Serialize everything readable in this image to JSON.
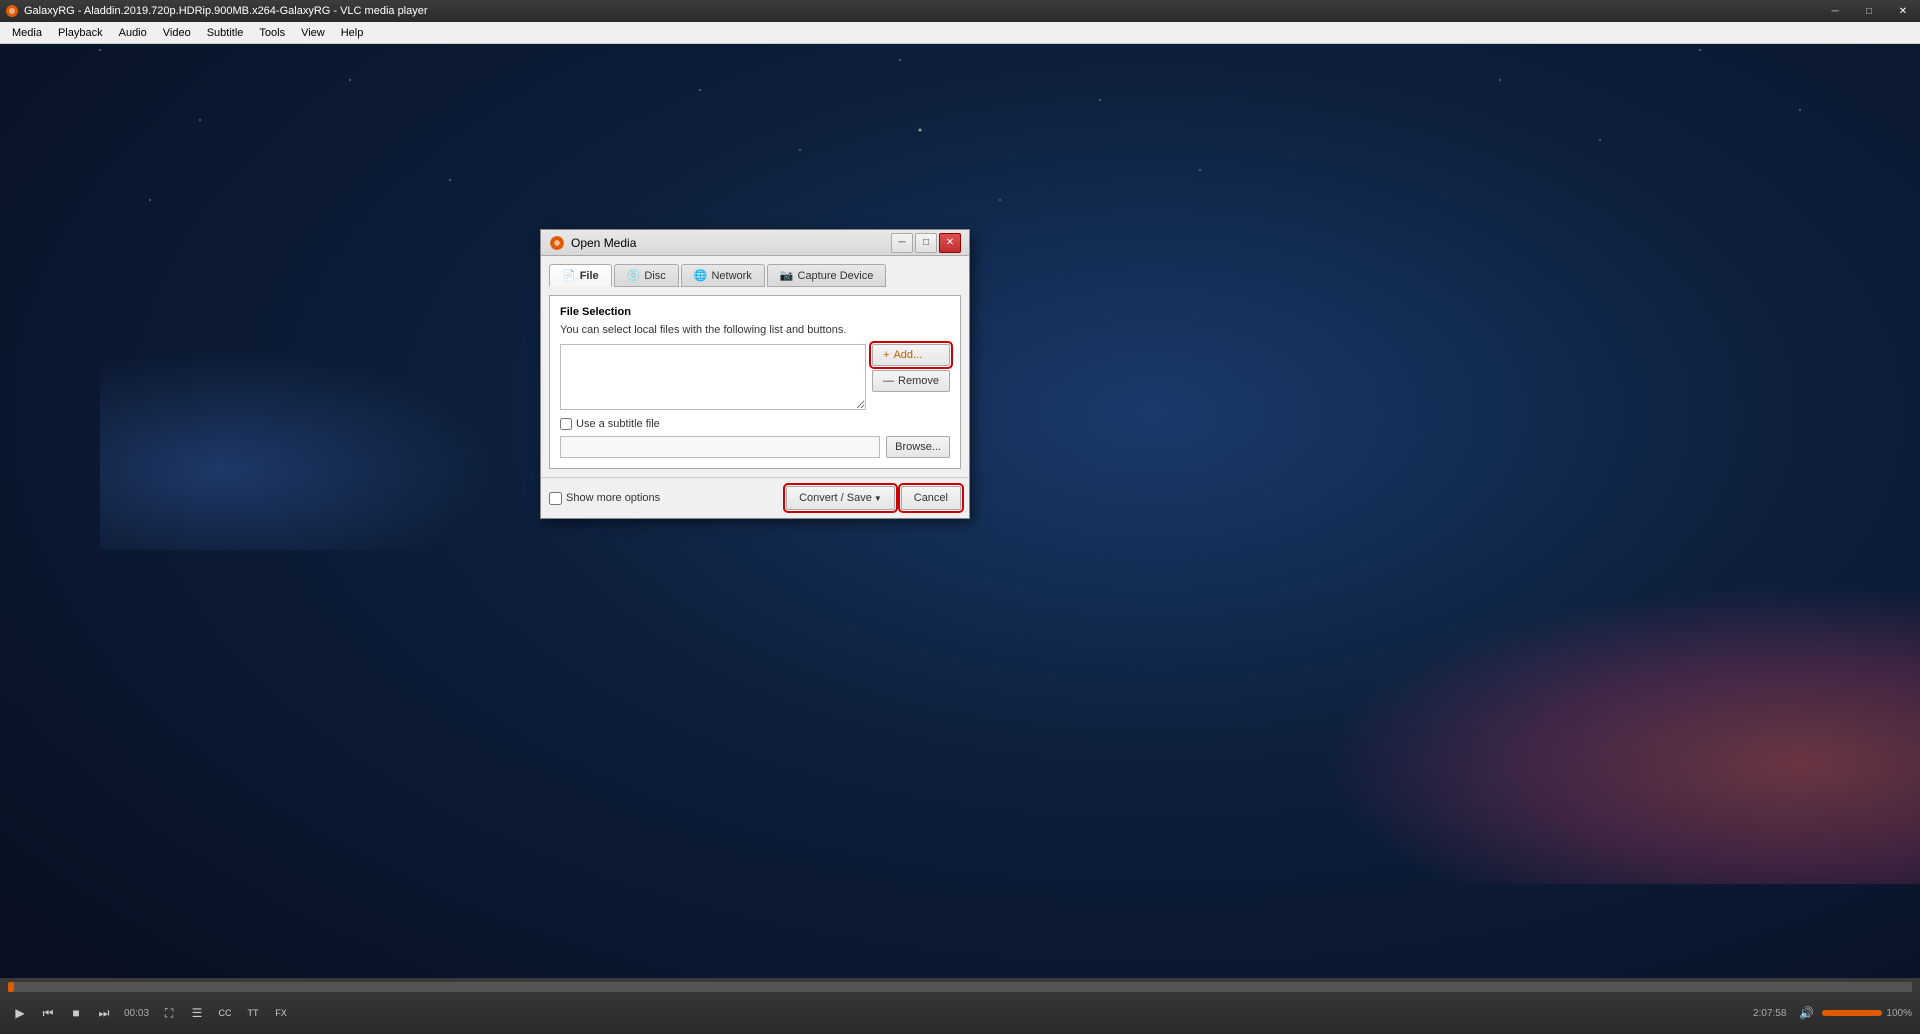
{
  "window": {
    "title": "GalaxyRG - Aladdin.2019.720p.HDRip.900MB.x264-GalaxyRG - VLC media player",
    "minimize_label": "─",
    "maximize_label": "□",
    "close_label": "✕"
  },
  "menubar": {
    "items": [
      {
        "id": "media",
        "label": "Media"
      },
      {
        "id": "playback",
        "label": "Playback"
      },
      {
        "id": "audio",
        "label": "Audio"
      },
      {
        "id": "video",
        "label": "Video"
      },
      {
        "id": "subtitle",
        "label": "Subtitle"
      },
      {
        "id": "tools",
        "label": "Tools"
      },
      {
        "id": "view",
        "label": "View"
      },
      {
        "id": "help",
        "label": "Help"
      }
    ]
  },
  "dialog": {
    "title": "Open Media",
    "minimize_label": "─",
    "maximize_label": "□",
    "close_label": "✕",
    "tabs": [
      {
        "id": "file",
        "label": "File",
        "active": true
      },
      {
        "id": "disc",
        "label": "Disc",
        "active": false
      },
      {
        "id": "network",
        "label": "Network",
        "active": false
      },
      {
        "id": "capture",
        "label": "Capture Device",
        "active": false
      }
    ],
    "file_tab": {
      "section_title": "File Selection",
      "section_desc": "You can select local files with the following list and buttons.",
      "add_button": "+ Add...",
      "remove_button": "— Remove",
      "subtitle_checkbox_label": "Use a subtitle file",
      "subtitle_input_value": "",
      "subtitle_input_placeholder": "",
      "browse_button": "Browse..."
    },
    "footer": {
      "show_more_label": "Show more options",
      "convert_save_label": "Convert / Save",
      "cancel_label": "Cancel"
    }
  },
  "bottombar": {
    "time_current": "00:03",
    "time_total": "2:07:58",
    "volume_label": "100%",
    "controls": {
      "play": "▶",
      "prev": "⏮",
      "stop": "■",
      "next": "⏭",
      "fullscreen": "⛶",
      "extended": "☰",
      "subtitle": "CC",
      "teletext": "TT",
      "effects": "FX",
      "frame_by_frame": "⏭"
    }
  },
  "icons": {
    "vlc": "🟠",
    "file_tab": "📄",
    "disc_tab": "💿",
    "network_tab": "🌐",
    "capture_tab": "📷",
    "add": "+",
    "remove": "—",
    "volume": "🔊"
  }
}
